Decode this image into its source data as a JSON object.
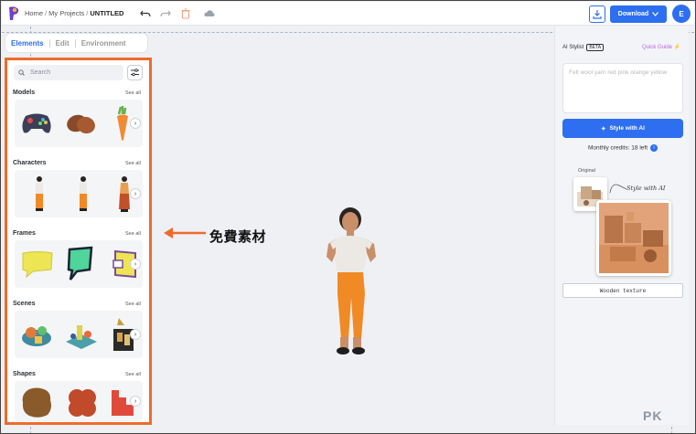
{
  "header": {
    "breadcrumbs": [
      "Home",
      "My Projects",
      "UNTITLED"
    ],
    "download_label": "Download",
    "avatar_initial": "E"
  },
  "tabs": [
    "Elements",
    "Edit",
    "Environment"
  ],
  "search": {
    "placeholder": "Search"
  },
  "sections": [
    {
      "title": "Models",
      "see_all": "See all"
    },
    {
      "title": "Characters",
      "see_all": "See all"
    },
    {
      "title": "Frames",
      "see_all": "See all"
    },
    {
      "title": "Scenes",
      "see_all": "See all"
    },
    {
      "title": "Shapes",
      "see_all": "See all"
    }
  ],
  "annotation": {
    "text": "免費素材"
  },
  "ai_panel": {
    "title": "AI Stylist",
    "badge": "BETA",
    "quick_guide": "Quick Guide",
    "prompt_text": "Felt wool yarn red pink orange yellow",
    "style_button": "Style with AI",
    "credits": "Monthly credits: 18 left",
    "original_label": "Original",
    "style_ai_label": "Style with AI",
    "texture_label": "Wooden texture"
  },
  "watermark": "PK",
  "colors": {
    "accent": "#2d6ff0",
    "highlight": "#f06a2b",
    "guide_pink": "#b46ad9"
  }
}
